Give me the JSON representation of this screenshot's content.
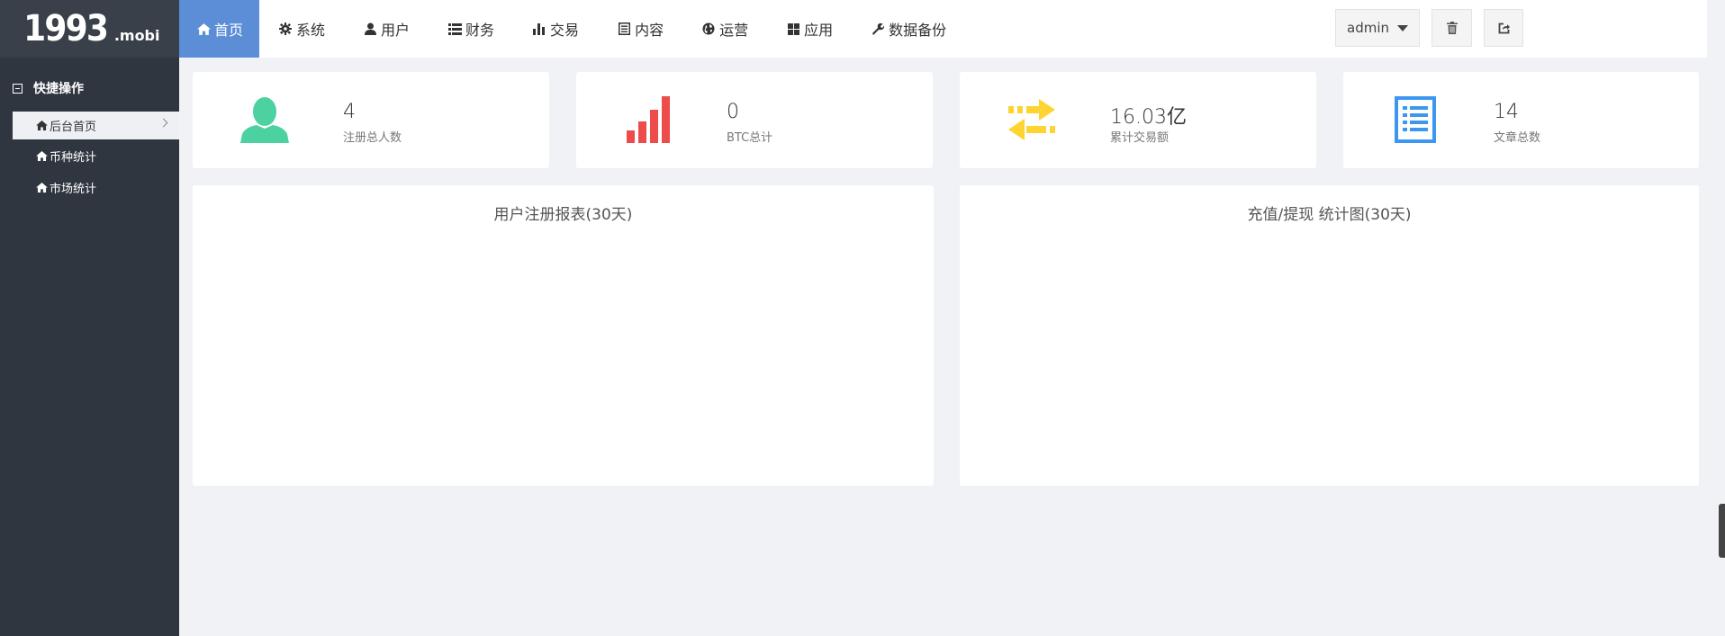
{
  "brand": {
    "logo_main": "1993",
    "logo_suffix": ".mobi"
  },
  "sidebar": {
    "section_title": "快捷操作",
    "items": [
      {
        "label": "后台首页",
        "icon": "home-icon",
        "active": true
      },
      {
        "label": "币种统计",
        "icon": "home-icon",
        "active": false
      },
      {
        "label": "市场统计",
        "icon": "home-icon",
        "active": false
      }
    ]
  },
  "nav": {
    "items": [
      {
        "label": "首页",
        "icon": "home-icon",
        "active": true
      },
      {
        "label": "系统",
        "icon": "gear-icon"
      },
      {
        "label": "用户",
        "icon": "user-icon"
      },
      {
        "label": "财务",
        "icon": "list-icon"
      },
      {
        "label": "交易",
        "icon": "bar-chart-icon"
      },
      {
        "label": "内容",
        "icon": "document-icon"
      },
      {
        "label": "运营",
        "icon": "globe-icon"
      },
      {
        "label": "应用",
        "icon": "grid-icon"
      },
      {
        "label": "数据备份",
        "icon": "wrench-icon"
      }
    ],
    "user": "admin"
  },
  "stats": [
    {
      "value": "4",
      "label": "注册总人数",
      "icon": "user-silhouette-icon",
      "color": "#4cd1a0"
    },
    {
      "value": "0",
      "label": "BTC总计",
      "icon": "signal-bars-icon",
      "color": "#ee4b4b"
    },
    {
      "value": "16.03亿",
      "label": "累计交易额",
      "icon": "transfer-arrows-icon",
      "color": "#fdd431"
    },
    {
      "value": "14",
      "label": "文章总数",
      "icon": "list-document-icon",
      "color": "#3d97f0"
    }
  ],
  "panels": [
    {
      "title": "用户注册报表(30天)"
    },
    {
      "title": "充值/提现 统计图(30天)"
    }
  ]
}
